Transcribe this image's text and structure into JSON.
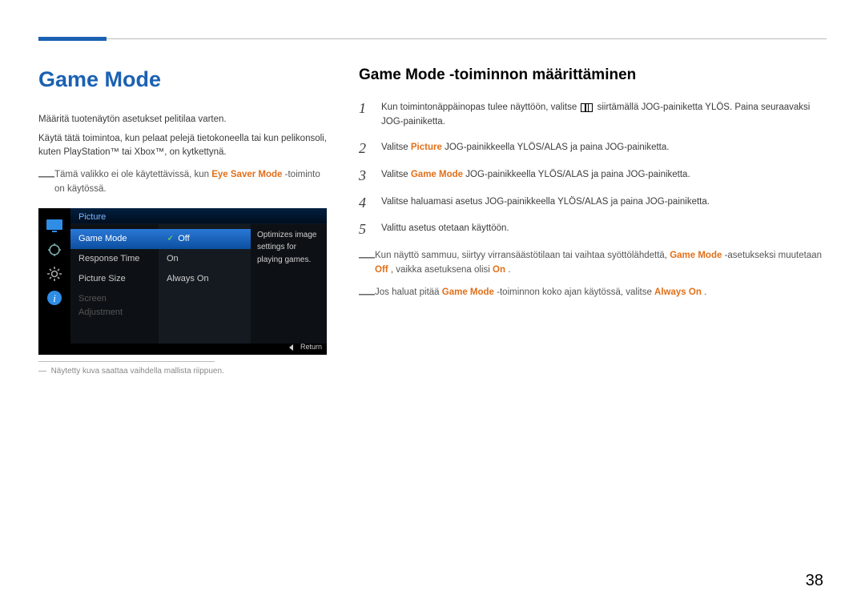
{
  "left": {
    "title": "Game Mode",
    "para1": "Määritä tuotenäytön asetukset pelitilaa varten.",
    "para2": "Käytä tätä toimintoa, kun pelaat pelejä tietokoneella tai kun pelikonsoli, kuten PlayStation™ tai Xbox™, on kytkettynä.",
    "note1_pre": "Tämä valikko ei ole käytettävissä, kun ",
    "note1_bold": "Eye Saver Mode",
    "note1_post": " -toiminto on käytössä.",
    "footnote": "Näytetty kuva saattaa vaihdella mallista riippuen."
  },
  "osd": {
    "section_title": "Picture",
    "menu": [
      "Game Mode",
      "Response Time",
      "Picture Size",
      "Screen Adjustment"
    ],
    "options": [
      "Off",
      "On",
      "Always On"
    ],
    "desc": "Optimizes image settings for playing games.",
    "return": "Return"
  },
  "right": {
    "title": "Game Mode -toiminnon määrittäminen",
    "step1_pre": "Kun toimintonäppäinopas tulee näyttöön, valitse ",
    "step1_post": " siirtämällä JOG-painiketta YLÖS. Paina seuraavaksi JOG-painiketta.",
    "step2_pre": "Valitse ",
    "step2_bold": "Picture",
    "step2_post": " JOG-painikkeella YLÖS/ALAS ja paina JOG-painiketta.",
    "step3_pre": "Valitse ",
    "step3_bold": "Game Mode",
    "step3_post": " JOG-painikkeella YLÖS/ALAS ja paina JOG-painiketta.",
    "step4": "Valitse haluamasi asetus JOG-painikkeella YLÖS/ALAS ja paina JOG-painiketta.",
    "step5": "Valittu asetus otetaan käyttöön.",
    "noteA_pre": "Kun näyttö sammuu, siirtyy virransäästötilaan tai vaihtaa syöttölähdettä, ",
    "noteA_b1": "Game Mode",
    "noteA_mid1": " -asetukseksi muutetaan ",
    "noteA_b2": "Off",
    "noteA_mid2": ", vaikka asetuksena olisi ",
    "noteA_b3": "On",
    "noteA_end": ".",
    "noteB_pre": "Jos haluat pitää ",
    "noteB_b1": "Game Mode",
    "noteB_mid": " -toiminnon koko ajan käytössä, valitse ",
    "noteB_b2": "Always On",
    "noteB_end": "."
  },
  "page_number": "38"
}
